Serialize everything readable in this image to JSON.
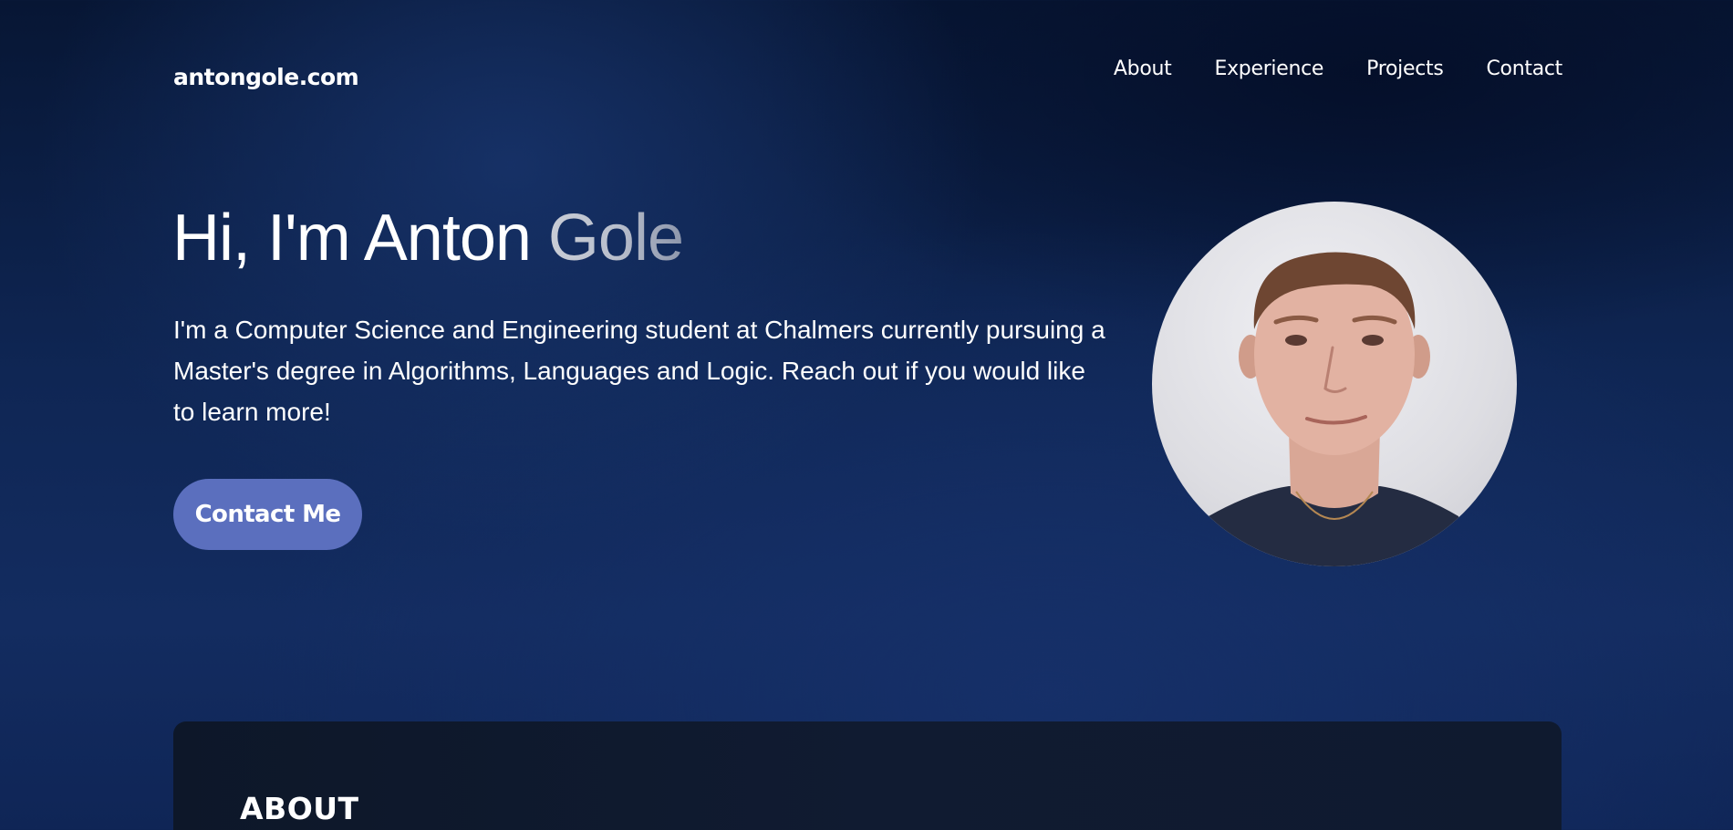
{
  "header": {
    "logo": "antongole.com",
    "nav": [
      {
        "label": "About"
      },
      {
        "label": "Experience"
      },
      {
        "label": "Projects"
      },
      {
        "label": "Contact"
      }
    ]
  },
  "hero": {
    "title_first": "Hi, I'm Anton ",
    "title_last": "Gole",
    "description": "I'm a Computer Science and Engineering student at Chalmers currently pursuing a Master's degree in Algorithms, Languages and Logic. Reach out if you would like to learn more!",
    "cta_label": "Contact Me"
  },
  "about": {
    "heading": "ABOUT"
  },
  "colors": {
    "background": "#0f2654",
    "button": "#5b6fbe",
    "card": "#0d1729",
    "text": "#ffffff"
  }
}
